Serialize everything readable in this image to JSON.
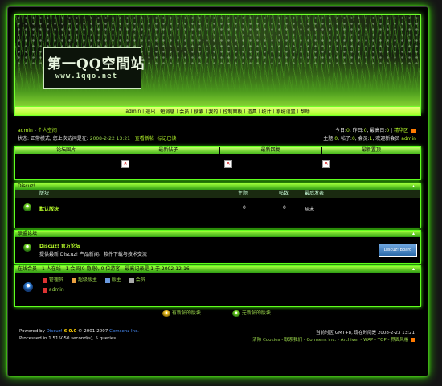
{
  "banner": {
    "logo_title": "第一QQ空間站",
    "logo_url": "www.1qqo.net"
  },
  "nav": {
    "items": [
      "admin",
      "退出",
      "短消息",
      "会员",
      "搜索",
      "我的",
      "控制面板",
      "道具",
      "统计",
      "系统设置",
      "帮助"
    ]
  },
  "user": {
    "name": "admin",
    "space": "个人空间",
    "status_label": "状态: 正常模式,",
    "last_visit_label": "您上次访问是在:",
    "last_visit": "2008-2-22 13:21",
    "view_new": "查看新帖",
    "mark_read": "标记已读"
  },
  "stats_right": {
    "line1_a": "今日:",
    "today": "0",
    "line1_b": ", 昨日:",
    "yesterday": "0",
    "line1_c": ", 最高日:",
    "max_day": "0",
    "elite": "精华区",
    "line2_a": "主题:",
    "topics": "0",
    "line2_b": ", 帖子:",
    "posts": "0",
    "line2_c": ", 会员:",
    "members": "1",
    "line2_d": ", 欢迎新会员",
    "newest": "admin"
  },
  "top_panel": {
    "cols": [
      "论坛图片",
      "最新帖子",
      "最新回复",
      "最新置顶"
    ]
  },
  "forum": {
    "title": "Discuz!",
    "col_board": "版块",
    "col_topics": "主题",
    "col_posts": "帖数",
    "col_last": "最后发表",
    "board_name": "默认版块",
    "board_topics": "0",
    "board_posts": "0",
    "board_last": "从未"
  },
  "links": {
    "title": "联盟论坛",
    "site_name": "Discuz! 官方论坛",
    "site_desc": "提供最新  Discuz! 产品新闻、软件下载与技术交流",
    "badge": "Discuz! Board"
  },
  "online": {
    "title": "在线会员 - 1 人在线 - 1 会员(0 隐身), 0 位游客 - 最高记录是 1 于 2002-12-16.",
    "legend": [
      "管理员",
      "超级版主",
      "版主",
      "会员"
    ],
    "online_user": "admin"
  },
  "legend_bottom": {
    "new_posts": "有新帖的版块",
    "no_new_posts": "无新帖的版块"
  },
  "footer": {
    "powered_label": "Powered by",
    "product": "Discuz!",
    "version": "6.0.0",
    "copyright": "© 2001-2007",
    "company": "Comsenz Inc.",
    "processed": "Processed in 1.515050 second(s), 5 queries.",
    "timezone_label": "当前时区",
    "timezone": "GMT+8, 现在时间是",
    "now": "2008-2-23 13:21",
    "links": "清除 Cookies - 联系我们 - Comsenz Inc. - Archiver - WAP - TOP - 界面风格"
  }
}
